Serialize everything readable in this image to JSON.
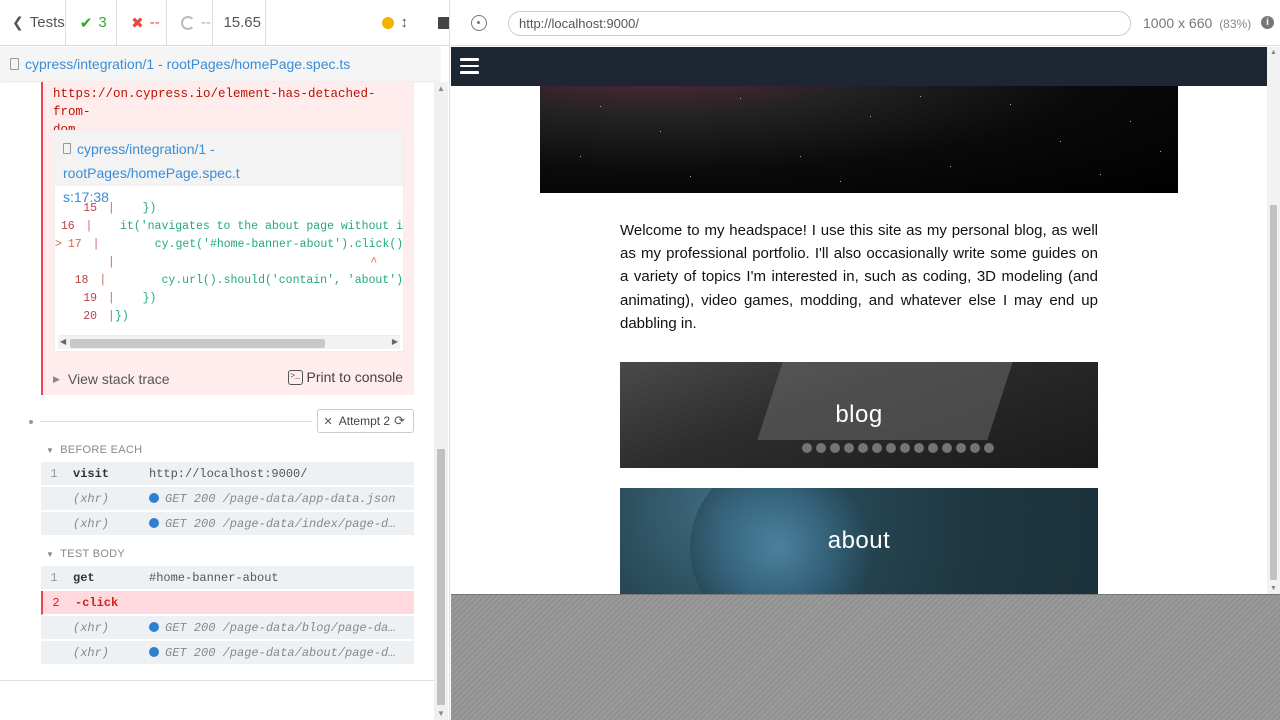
{
  "stats": {
    "tests_label": "Tests",
    "passed": "3",
    "failed": "--",
    "pending": "--",
    "duration": "15.65"
  },
  "spec": {
    "path": "cypress/integration/1 - rootPages/homePage.spec.ts"
  },
  "error": {
    "link_line1": "https://on.cypress.io/element-has-detached-from-",
    "link_line2": "dom",
    "code_frame_file_line1": "cypress/integration/1 - rootPages/homePage.spec.t",
    "code_frame_file_line2": "s:17:38",
    "code_lines": [
      {
        "num": "15",
        "marker": "",
        "text": "    })"
      },
      {
        "num": "16",
        "marker": "",
        "text": "    it('navigates to the about page without i"
      },
      {
        "num": "17",
        "marker": ">",
        "text": "        cy.get('#home-banner-about').click()"
      },
      {
        "num": "",
        "marker": "",
        "text": "                                     ^"
      },
      {
        "num": "18",
        "marker": "",
        "text": "        cy.url().should('contain', 'about')"
      },
      {
        "num": "19",
        "marker": "",
        "text": "    })"
      },
      {
        "num": "20",
        "marker": "",
        "text": "})"
      }
    ],
    "view_stack_trace": "View stack trace",
    "print_to_console": "Print to console"
  },
  "attempt": {
    "label": "Attempt 2"
  },
  "before_each": {
    "title": "BEFORE EACH",
    "commands": [
      {
        "idx": "1",
        "name": "visit",
        "value": "http://localhost:9000/",
        "xhr": false
      },
      {
        "idx": "",
        "name": "(xhr)",
        "value": "GET 200 /page-data/app-data.json",
        "xhr": true
      },
      {
        "idx": "",
        "name": "(xhr)",
        "value": "GET 200 /page-data/index/page-d…",
        "xhr": true
      }
    ]
  },
  "test_body": {
    "title": "TEST BODY",
    "commands": [
      {
        "idx": "1",
        "name": "get",
        "value": "#home-banner-about",
        "xhr": false
      },
      {
        "idx": "2",
        "name": "-click",
        "value": "",
        "xhr": false,
        "failed": true
      },
      {
        "idx": "",
        "name": "(xhr)",
        "value": "GET 200 /page-data/blog/page-da…",
        "xhr": true
      },
      {
        "idx": "",
        "name": "(xhr)",
        "value": "GET 200 /page-data/about/page-d…",
        "xhr": true
      }
    ]
  },
  "aut": {
    "url": "http://localhost:9000/",
    "viewport": "1000 x 660",
    "scale": "(83%)",
    "info_icon": "i"
  },
  "site": {
    "welcome_text": "Welcome to my headspace! I use this site as my personal blog, as well as my professional portfolio. I'll also occasionally write some guides on a variety of topics I'm interested in, such as coding, 3D modeling (and animating), video games, modding, and whatever else I may end up dabbling in.",
    "banner_blog": "blog",
    "banner_about": "about"
  },
  "icons": {
    "back": "chevron-left-icon",
    "passed": "check-icon",
    "failed": "x-icon",
    "pending": "spinner-icon",
    "running": "yellow-dot-icon",
    "autoscroll": "vertical-arrows-icon",
    "stop": "stop-icon",
    "selector": "crosshair-icon",
    "menu": "hamburger-icon"
  }
}
